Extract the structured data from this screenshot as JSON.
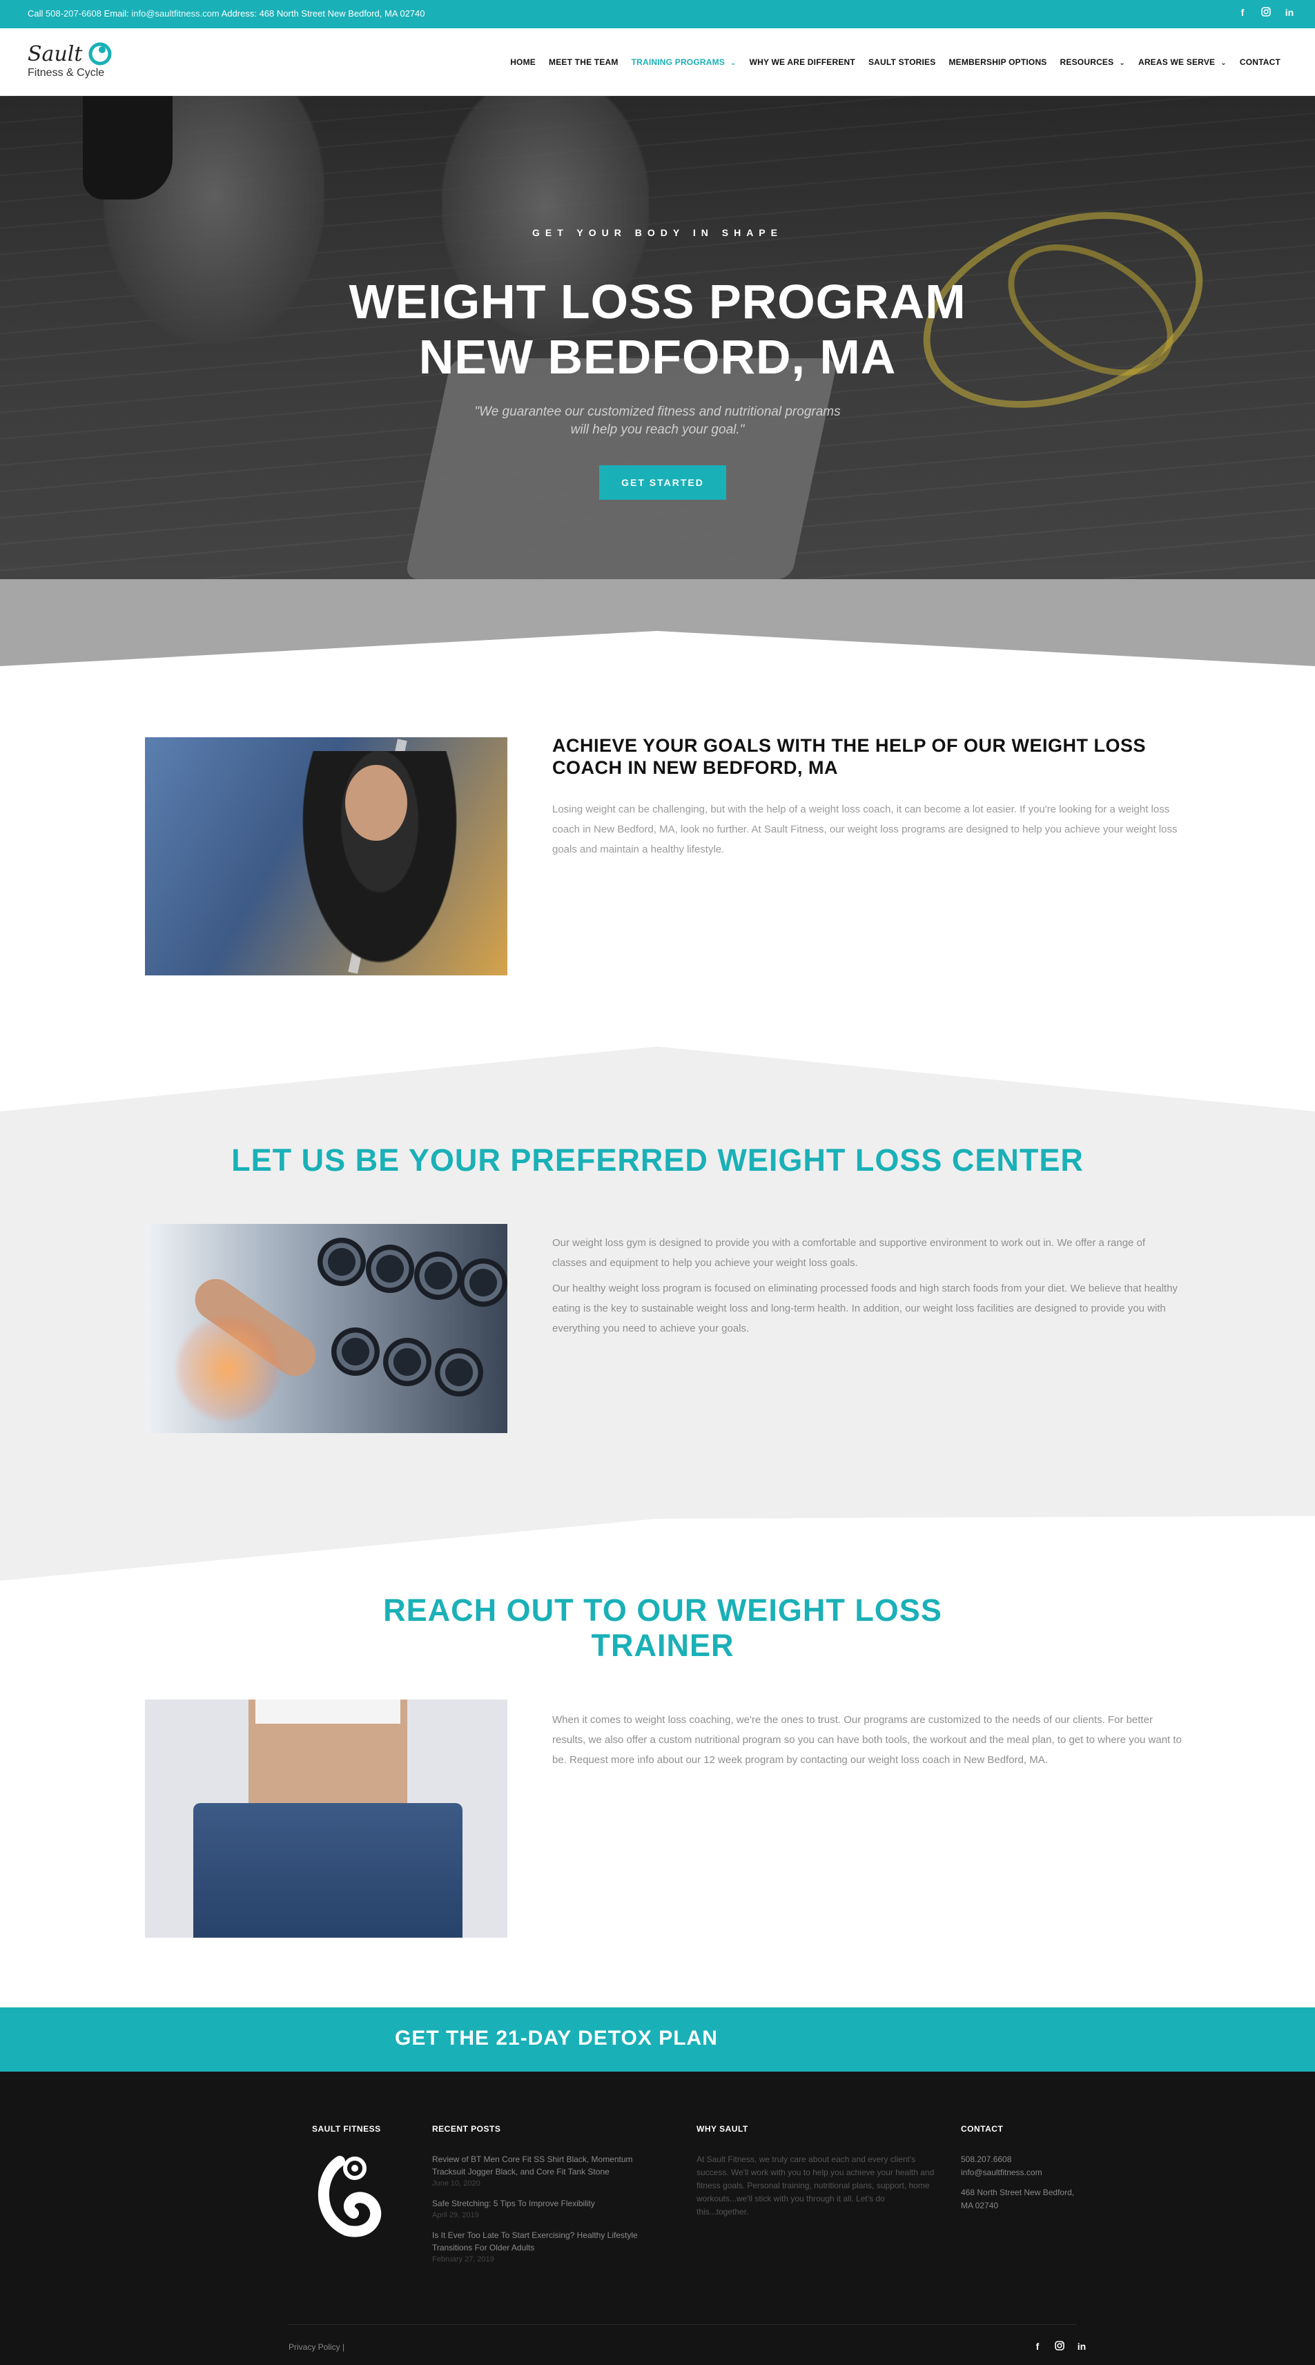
{
  "topbar": {
    "call_label": "Call",
    "phone": "508-207-6608",
    "email_label": "Email:",
    "email": "info@saultfitness.com",
    "address_label": "Address:",
    "address": "468 North Street New Bedford, MA 02740",
    "social_icons": [
      "facebook-icon",
      "instagram-icon",
      "linkedin-icon"
    ]
  },
  "logo": {
    "line1": "Sault",
    "line2": "Fitness & Cycle"
  },
  "nav": {
    "items": [
      {
        "label": "HOME",
        "active": false,
        "has_caret": false
      },
      {
        "label": "MEET THE TEAM",
        "active": false,
        "has_caret": false
      },
      {
        "label": "TRAINING PROGRAMS",
        "active": true,
        "has_caret": true
      },
      {
        "label": "WHY WE ARE DIFFERENT",
        "active": false,
        "has_caret": false
      },
      {
        "label": "SAULT STORIES",
        "active": false,
        "has_caret": false
      },
      {
        "label": "MEMBERSHIP OPTIONS",
        "active": false,
        "has_caret": false
      },
      {
        "label": "RESOURCES",
        "active": false,
        "has_caret": true
      },
      {
        "label": "AREAS WE SERVE",
        "active": false,
        "has_caret": true
      },
      {
        "label": "CONTACT",
        "active": false,
        "has_caret": false
      }
    ]
  },
  "hero": {
    "kicker": "GET YOUR BODY IN SHAPE",
    "title_line1": "WEIGHT LOSS PROGRAM",
    "title_line2": "NEW BEDFORD, MA",
    "quote_line1": "\"We guarantee our customized fitness and nutritional programs",
    "quote_line2": "will help you reach your goal.\"",
    "cta": "GET STARTED"
  },
  "section1": {
    "heading": "ACHIEVE YOUR GOALS WITH THE HELP OF OUR WEIGHT LOSS COACH IN NEW BEDFORD, MA",
    "body": "Losing weight can be challenging, but with the help of a weight loss coach, it can become a lot easier. If you're looking for a weight loss coach in New Bedford, MA, look no further. At Sault Fitness, our weight loss programs are designed to help you achieve your weight loss goals and maintain a healthy lifestyle."
  },
  "section2": {
    "heading": "LET US BE YOUR PREFERRED WEIGHT LOSS CENTER",
    "para1": "Our weight loss gym is designed to provide you with a comfortable and supportive environment to work out in. We offer a range of classes and equipment to help you achieve your weight loss goals.",
    "para2": "Our healthy weight loss program is focused on eliminating processed foods and high starch foods from your diet. We believe that healthy eating is the key to sustainable weight loss and long-term health. In addition, our weight loss facilities are designed to provide you with everything you need to achieve your goals."
  },
  "section3": {
    "heading_line1": "REACH OUT TO OUR WEIGHT LOSS",
    "heading_line2": "TRAINER",
    "body": "When it comes to weight loss coaching, we're the ones to trust. Our programs are customized to the needs of our clients. For better results, we also offer a custom nutritional program so you can have both tools, the workout and the meal plan, to get to where you want to be. Request more info about our 12 week program by contacting our weight loss coach in New Bedford, MA."
  },
  "detox_band": {
    "label": "GET THE 21-DAY DETOX PLAN"
  },
  "footer": {
    "col1_title": "SAULT FITNESS",
    "col2_title": "RECENT POSTS",
    "posts": [
      {
        "title": "Review of BT Men Core Fit SS Shirt Black, Momentum Tracksuit Jogger Black, and Core Fit Tank Stone",
        "date": "June 10, 2020"
      },
      {
        "title": "Safe Stretching: 5 Tips To Improve Flexibility",
        "date": "April 29, 2019"
      },
      {
        "title": "Is It Ever Too Late To Start Exercising? Healthy Lifestyle Transitions For Older Adults",
        "date": "February 27, 2019"
      }
    ],
    "col3_title": "WHY SAULT",
    "why_text": "At Sault Fitness, we truly care about each and every client's success. We'll work with you to help you achieve your health and fitness goals. Personal training, nutritional plans, support, home workouts...we'll stick with you through it all. Let's do this...together.",
    "col4_title": "CONTACT",
    "contact_phone": "508.207.6608",
    "contact_email": "info@saultfitness.com",
    "contact_address_line1": "468 North Street New Bedford,",
    "contact_address_line2": "MA 02740",
    "privacy": "Privacy Policy",
    "privacy_sep": "|",
    "social_icons": [
      "facebook-icon",
      "instagram-icon",
      "linkedin-icon"
    ]
  },
  "colors": {
    "accent": "#1ab0b7",
    "footer_bg": "#141414",
    "section_gray": "#efefef"
  }
}
